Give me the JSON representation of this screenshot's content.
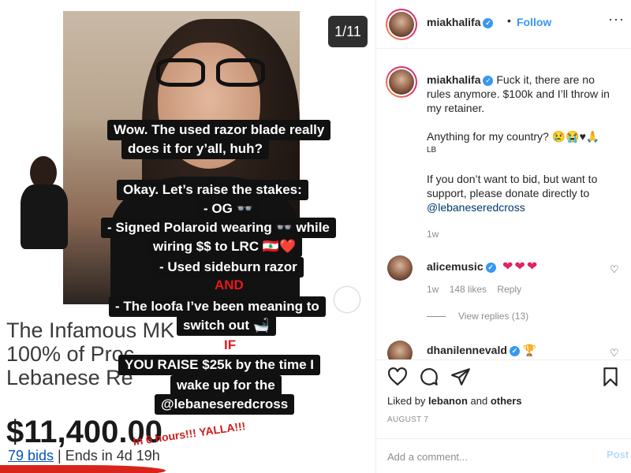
{
  "story": {
    "counter": "1/11",
    "captions": [
      "Wow. The used razor blade really",
      "does it for y’all, huh?",
      "Okay. Let’s raise the stakes:",
      "- OG 👓",
      "- Signed Polaroid wearing 👓 while",
      "wiring $$ to LRC 🇱🇧❤️",
      "- Used sideburn razor",
      "AND",
      "- The loofa I’ve been meaning to",
      "switch out 🛁",
      "IF",
      "YOU RAISE $25k by the time I",
      "wake up for the",
      "@lebaneseredcross"
    ],
    "listing_title_lines": [
      "The Infamous MK",
      "100% of Proc",
      "Lebanese Re"
    ],
    "price": "$11,400.00",
    "bids_link": "79 bids",
    "ends": " | Ends in 4d 19h",
    "handwritten_note": "In 6 hours!!! YALLA!!!"
  },
  "post": {
    "username": "miakhalifa",
    "follow": "Follow",
    "dot": "•",
    "more": "···",
    "caption": {
      "line1": "Fuck it, there are no",
      "line2": "rules anymore. $100k and I’ll throw in",
      "line3": "my retainer.",
      "line4": "Anything for my country? 😢😭♥🙏",
      "line5": "LB",
      "line6": "If you don’t want to bid, but want to",
      "line7": "support, please donate directly to",
      "mention": "@lebaneseredcross"
    },
    "caption_time": "1w",
    "comments": [
      {
        "user": "alicemusic",
        "text": "❤❤❤",
        "time": "1w",
        "likes": "148 likes",
        "reply": "Reply",
        "view_replies": "View replies (13)"
      },
      {
        "user": "dhanilennevald",
        "text": "🏆"
      }
    ],
    "liked_by_prefix": "Liked by ",
    "liked_by_user": "lebanon",
    "liked_by_mid": " and ",
    "liked_by_others": "others",
    "date": "AUGUST 7",
    "add_comment_placeholder": "Add a comment...",
    "post_button": "Post"
  },
  "colors": {
    "accent": "#3897f0",
    "caption_bg": "#111111",
    "caption_red": "#e5181b"
  },
  "icons": [
    "heart-icon",
    "comment-icon",
    "share-icon",
    "bookmark-icon",
    "more-icon",
    "verified-icon"
  ]
}
